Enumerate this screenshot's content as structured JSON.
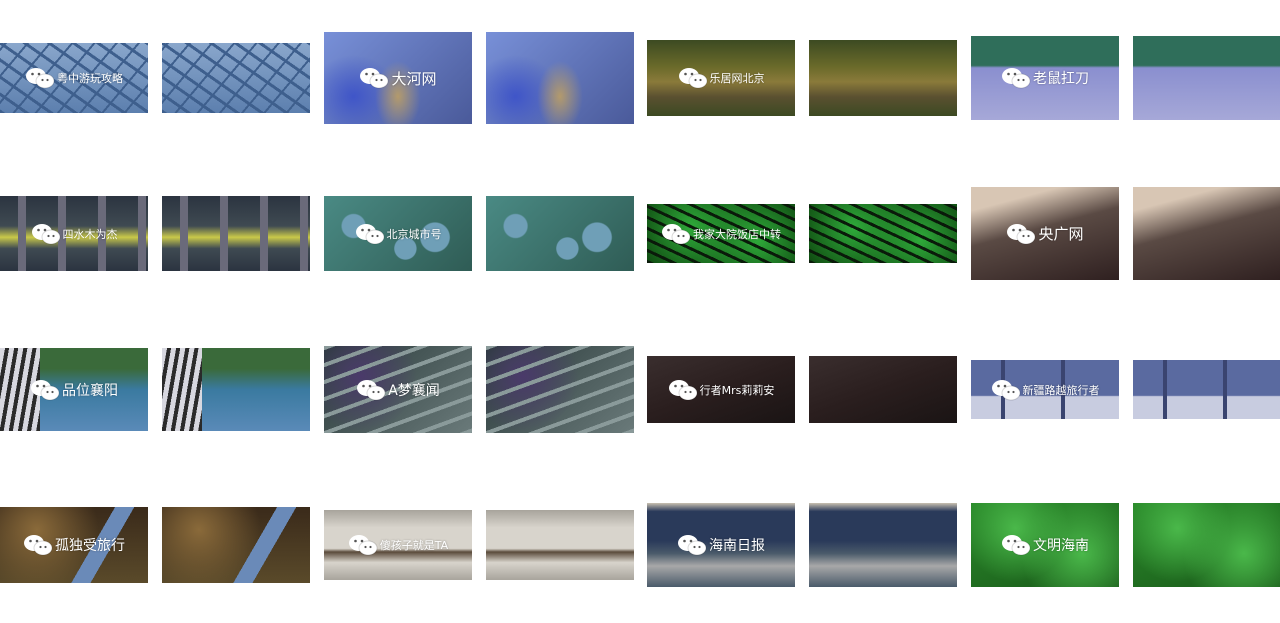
{
  "tiles": [
    {
      "watermark": "粤中游玩攻略",
      "image": "cracked-blue-texture",
      "palette": [
        "#5c7fae",
        "#3e5f8d",
        "#8aa7cc"
      ]
    },
    {
      "watermark": "大河网",
      "image": "blurred-blue-figure",
      "palette": [
        "#7890d8",
        "#3f55c8",
        "#b39a6c"
      ]
    },
    {
      "watermark": "乐居网北京",
      "image": "river-landscape",
      "palette": [
        "#6a6a2a",
        "#8a7a3a",
        "#3c4a22"
      ]
    },
    {
      "watermark": "老鼠扛刀",
      "image": "plaza-with-trees",
      "palette": [
        "#8a8fcf",
        "#a6a8d8",
        "#2f6e5a"
      ]
    },
    {
      "watermark": "四水木为杰",
      "image": "yellow-railing-pillars",
      "palette": [
        "#3f4a52",
        "#c9c94a",
        "#2b3440"
      ]
    },
    {
      "watermark": "北京城市号",
      "image": "blue-plums-leaves",
      "palette": [
        "#4a8a84",
        "#6f9fb7",
        "#2f5c55"
      ]
    },
    {
      "watermark": "我家大院饭店中转",
      "image": "green-tree-branches",
      "palette": [
        "#0a3a0a",
        "#2faa3a",
        "#0a1a0a"
      ]
    },
    {
      "watermark": "央广网",
      "image": "misty-mountain",
      "palette": [
        "#d8c6b4",
        "#5a4a44",
        "#2f2020"
      ]
    },
    {
      "watermark": "品位襄阳",
      "image": "blurred-tiger-fur",
      "palette": [
        "#3a7aa0",
        "#5a8ab8",
        "#3a6a3a"
      ]
    },
    {
      "watermark": "A梦襄闻",
      "image": "garden-stone-steps",
      "palette": [
        "#3a4a4a",
        "#6a7a7a",
        "#2a3a3a"
      ]
    },
    {
      "watermark": "行者Mrs莉莉安",
      "image": "dark-stone-texture",
      "palette": [
        "#2a1e1e",
        "#3a2e2e",
        "#1a1414"
      ]
    },
    {
      "watermark": "新疆路越旅行者",
      "image": "temple-courtyard-figures",
      "palette": [
        "#5a6aa0",
        "#c8cce0",
        "#3a4470"
      ]
    },
    {
      "watermark": "孤独受旅行",
      "image": "autumn-pavilion",
      "palette": [
        "#3a2a1a",
        "#8a6a3a",
        "#6a8ab8"
      ]
    },
    {
      "watermark": "傻孩子就是TA",
      "image": "curved-white-architecture",
      "palette": [
        "#d8d4cc",
        "#5a4a3a",
        "#a8a49c"
      ]
    },
    {
      "watermark": "海南日报",
      "image": "chinese-city-gate",
      "palette": [
        "#2a3a5a",
        "#a8a8a8",
        "#4a5a6a"
      ]
    },
    {
      "watermark": "文明海南",
      "image": "lush-green-foliage",
      "palette": [
        "#2a8a2a",
        "#4ab84a",
        "#1a5a1a"
      ]
    }
  ]
}
